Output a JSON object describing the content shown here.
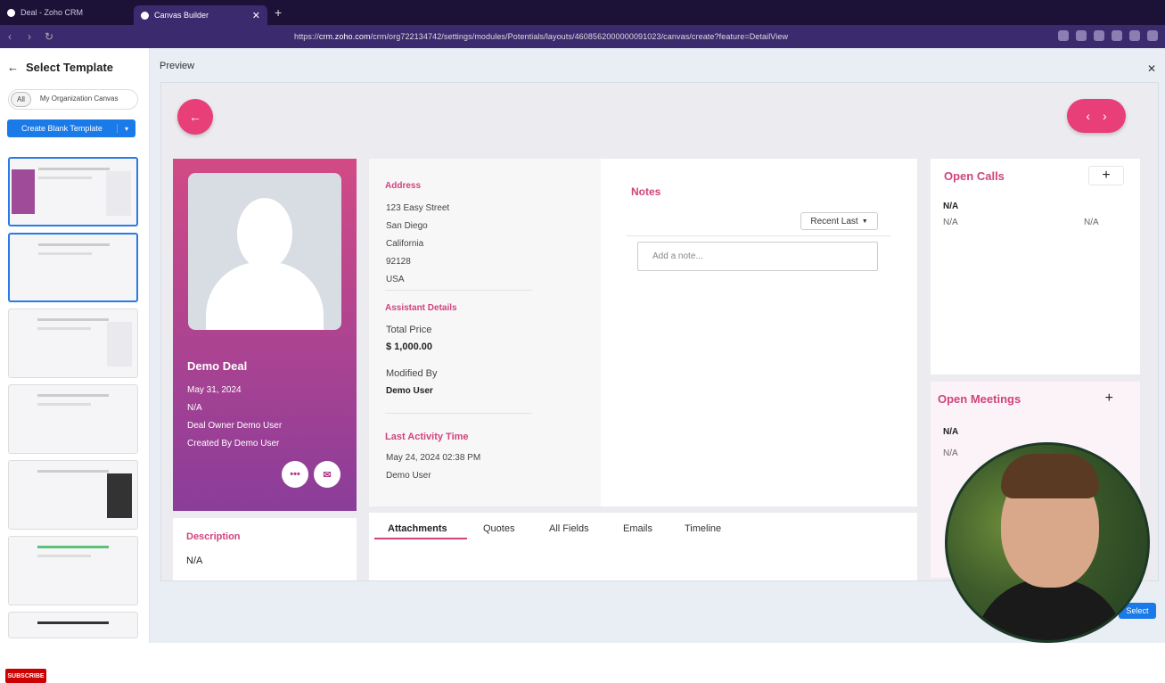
{
  "browser": {
    "tabs": [
      {
        "label": "Deal - Zoho CRM"
      },
      {
        "label": "Canvas Builder"
      }
    ],
    "url_prefix": "https://",
    "url_domain": "crm.zoho.com",
    "url_path": "/crm/org722134742/settings/modules/Potentials/layouts/4608562000000091023/canvas/create?feature=DetailView"
  },
  "sidebar": {
    "title": "Select Template",
    "filters": [
      "All",
      "My Organization Canvas"
    ],
    "create_label": "Create Blank Template",
    "subscribe_label": "SUBSCRIBE"
  },
  "main": {
    "preview_label": "Preview",
    "select_label": "Select"
  },
  "profile": {
    "name": "Demo Deal",
    "date": "May 31, 2024",
    "na": "N/A",
    "deal_owner": "Deal Owner   Demo User",
    "created_by": "Created By   Demo User"
  },
  "details": {
    "address_heading": "Address",
    "address_lines": [
      "123 Easy Street",
      "San Diego",
      "California",
      "92128",
      "USA"
    ],
    "assistant_heading": "Assistant Details",
    "total_price_label": "Total Price",
    "total_price_value": "$ 1,000.00",
    "modified_by_label": "Modified By",
    "modified_by_value": "Demo User",
    "last_activity_heading": "Last Activity Time",
    "last_activity_value": "May 24, 2024 02:38 PM",
    "last_activity_user": "Demo User"
  },
  "notes": {
    "heading": "Notes",
    "sort_label": "Recent Last",
    "placeholder": "Add a note..."
  },
  "open_calls": {
    "heading": "Open Calls",
    "na_bold": "N/A",
    "na_1": "N/A",
    "na_2": "N/A"
  },
  "open_meetings": {
    "heading": "Open Meetings",
    "na_bold": "N/A",
    "na_1": "N/A"
  },
  "description": {
    "heading": "Description",
    "value": "N/A"
  },
  "tabs": [
    "Attachments",
    "Quotes",
    "All Fields",
    "Emails",
    "Timeline"
  ],
  "colors": {
    "accent": "#e83f79",
    "heading_pink": "#d0447c",
    "primary_blue": "#1a7ae8"
  }
}
